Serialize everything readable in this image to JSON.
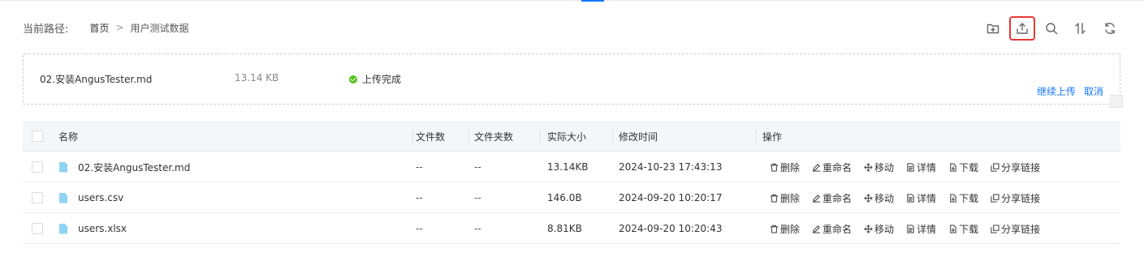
{
  "breadcrumb": {
    "label": "当前路径:",
    "home": "首页",
    "separator": ">",
    "current": "用户测试数据"
  },
  "toolbar": {
    "icons": [
      "folder-add-icon",
      "upload-icon",
      "search-icon",
      "sort-icon",
      "refresh-icon"
    ],
    "active": "upload-icon",
    "active_color": "#e53935"
  },
  "upload": {
    "file_name": "02.安装AngusTester.md",
    "file_size": "13.14 KB",
    "status": "上传完成",
    "status_color": "#52c41a",
    "continue_label": "继续上传",
    "cancel_label": "取消"
  },
  "table": {
    "headers": {
      "name": "名称",
      "files": "文件数",
      "folders": "文件夹数",
      "size": "实际大小",
      "mtime": "修改时间",
      "ops": "操作"
    },
    "ops": [
      "删除",
      "重命名",
      "移动",
      "详情",
      "下载",
      "分享链接"
    ],
    "rows": [
      {
        "name": "02.安装AngusTester.md",
        "files": "--",
        "folders": "--",
        "size": "13.14KB",
        "mtime": "2024-10-23 17:43:13"
      },
      {
        "name": "users.csv",
        "files": "--",
        "folders": "--",
        "size": "146.0B",
        "mtime": "2024-09-20 10:20:17"
      },
      {
        "name": "users.xlsx",
        "files": "--",
        "folders": "--",
        "size": "8.81KB",
        "mtime": "2024-09-20 10:20:43"
      }
    ]
  },
  "colors": {
    "accent": "#1677ff",
    "file_icon": "#8fd3f4"
  }
}
